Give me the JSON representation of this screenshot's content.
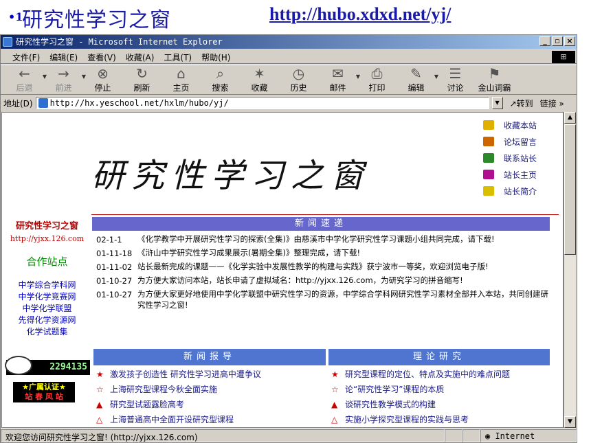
{
  "slide": {
    "bullet": "•1.",
    "title": "研究性学习之窗",
    "url": "http://hubo.xdxd.net/yj/"
  },
  "window": {
    "title": "研究性学习之窗 - Microsoft Internet Explorer",
    "min": "_",
    "max": "▫",
    "close": "×"
  },
  "menu": [
    "文件(F)",
    "编辑(E)",
    "查看(V)",
    "收藏(A)",
    "工具(T)",
    "帮助(H)"
  ],
  "toolbar": [
    {
      "label": "后退",
      "icon": "←",
      "disabled": true,
      "dd": true
    },
    {
      "label": "前进",
      "icon": "→",
      "disabled": true,
      "dd": true
    },
    {
      "label": "停止",
      "icon": "⊗"
    },
    {
      "label": "刷新",
      "icon": "↻"
    },
    {
      "label": "主页",
      "icon": "⌂"
    },
    {
      "label": "搜索",
      "icon": "⌕"
    },
    {
      "label": "收藏",
      "icon": "✶"
    },
    {
      "label": "历史",
      "icon": "◷"
    },
    {
      "label": "邮件",
      "icon": "✉",
      "dd": true
    },
    {
      "label": "打印",
      "icon": "⎙"
    },
    {
      "label": "编辑",
      "icon": "✎",
      "dd": true
    },
    {
      "label": "讨论",
      "icon": "☰"
    },
    {
      "label": "金山词霸",
      "icon": "⚑"
    }
  ],
  "address": {
    "label": "地址(D)",
    "value": "http://hx.yeschool.net/hxlm/hubo/yj/",
    "go": "转到",
    "links": "链接 »"
  },
  "page": {
    "banner_title": "研究性学习之窗",
    "quick_links": [
      "收藏本站",
      "论坛留言",
      "联系站长",
      "站长主页",
      "站长简介"
    ],
    "quick_colors": [
      "#e0b000",
      "#cc6600",
      "#2a8a2a",
      "#b01090",
      "#d8c000"
    ],
    "left": {
      "logo": "研究性学习之窗",
      "url": "http://yjxx.126.com",
      "coop": "合作站点",
      "links": [
        "中学综合学科网",
        "中学化学竞赛网",
        "中学化学联盟",
        "先得化学资源网",
        "化学试题集"
      ],
      "counter": "2294135",
      "cert1": "★广属认证★",
      "cert2": "站 春 风 站"
    },
    "news_header": "新闻速递",
    "news": [
      {
        "date": "02-1-1",
        "text": "《化学教学中开展研究性学习的探索(全集)》由慈溪市中学化学研究性学习课题小组共同完成，请下载!"
      },
      {
        "date": "01-11-18",
        "text": "《浒山中学研究性学习成果展示(暑期全集)》整理完成，请下载!"
      },
      {
        "date": "01-11-02",
        "text": "站长最新完成的课题——《化学实验中发展性教学的构建与实践》获宁波市一等奖，欢迎浏览电子版!"
      },
      {
        "date": "01-10-27",
        "text": "为方便大家访问本站，站长申请了虚拟域名：http://yjxx.126.com，为研究学习的拼音缩写!"
      },
      {
        "date": "01-10-27",
        "text": "为方便大家更好地使用中学化学联盟中研究性学习的资源，中学综合学科网研究性学习素材全部并入本站，共同创建研究性学习之窗!"
      }
    ],
    "report_header": "新闻报导",
    "theory_header": "理论研究",
    "reports": [
      {
        "mark": "★",
        "text": "激发孩子创造性 研究性学习进高中遭争议"
      },
      {
        "mark": "☆",
        "text": "上海研究型课程今秋全面实施"
      },
      {
        "mark": "▲",
        "text": "研究型试题露脸高考"
      },
      {
        "mark": "△",
        "text": "上海普通高中全面开设研究型课程"
      }
    ],
    "theory": [
      {
        "mark": "★",
        "text": "研究型课程的定位、特点及实施中的难点问题"
      },
      {
        "mark": "☆",
        "text": "论“研究性学习”课程的本质"
      },
      {
        "mark": "▲",
        "text": "谈研究性教学模式的构建"
      },
      {
        "mark": "△",
        "text": "实施小学探究型课程的实践与思考"
      }
    ]
  },
  "status": {
    "text": "欢迎您访问研究性学习之窗! (http://yjxx.126.com)",
    "zone": "Internet"
  }
}
